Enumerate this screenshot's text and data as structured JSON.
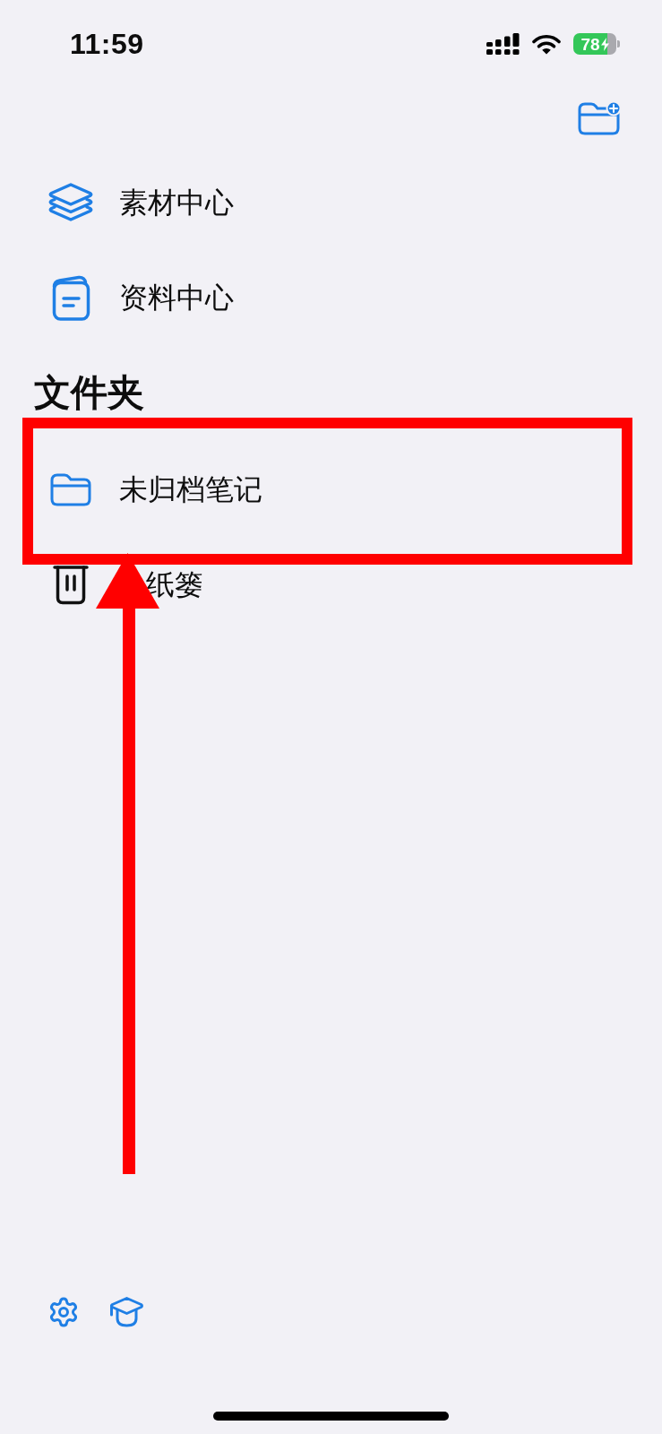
{
  "status_bar": {
    "time": "11:59",
    "battery": "78",
    "charging": true
  },
  "menu": [
    {
      "kind": "layers",
      "label": "素材中心"
    },
    {
      "kind": "document",
      "label": "资料中心"
    }
  ],
  "folders": {
    "title": "文件夹",
    "items": [
      {
        "kind": "folder",
        "label": "未归档笔记",
        "highlighted": true
      },
      {
        "kind": "trash",
        "label": "纸篓",
        "highlighted": false
      }
    ]
  }
}
